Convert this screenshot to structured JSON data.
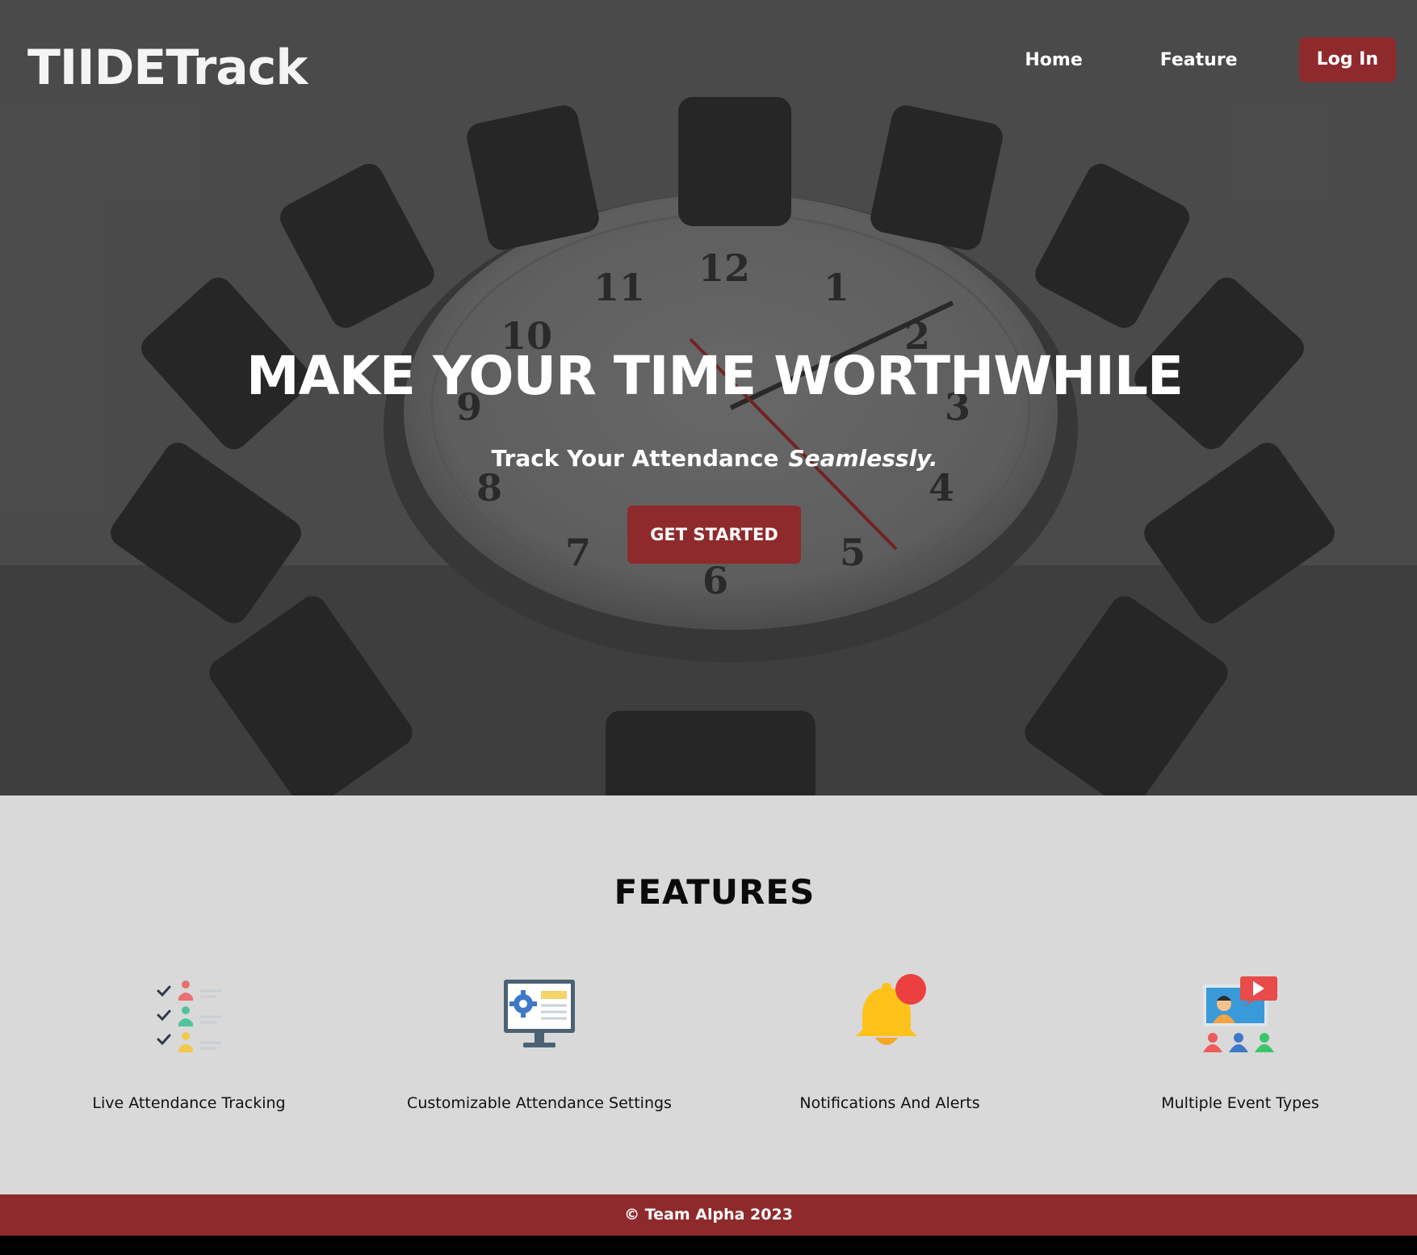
{
  "header": {
    "brand": "TIIDETrack",
    "nav": {
      "home": "Home",
      "feature": "Feature",
      "login": "Log In"
    }
  },
  "hero": {
    "title": "MAKE YOUR TIME WORTHWHILE",
    "subtitle": "Track Your Attendance",
    "subtitle_emphasis": "Seamlessly.",
    "cta": "GET STARTED",
    "background_image": "clock-table-chairs-photo"
  },
  "features": {
    "title": "FEATURES",
    "items": [
      {
        "label": "Live Attendance Tracking",
        "icon": "checklist-people-icon"
      },
      {
        "label": "Customizable Attendance Settings",
        "icon": "monitor-settings-icon"
      },
      {
        "label": "Notifications And Alerts",
        "icon": "bell-notification-icon"
      },
      {
        "label": "Multiple Event Types",
        "icon": "video-event-icon"
      }
    ]
  },
  "footer": {
    "copyright": "© Team Alpha 2023"
  },
  "colors": {
    "accent": "#8f2a2c",
    "features_bg": "#d9d9d9",
    "hero_overlay": "#5f5f5f"
  }
}
